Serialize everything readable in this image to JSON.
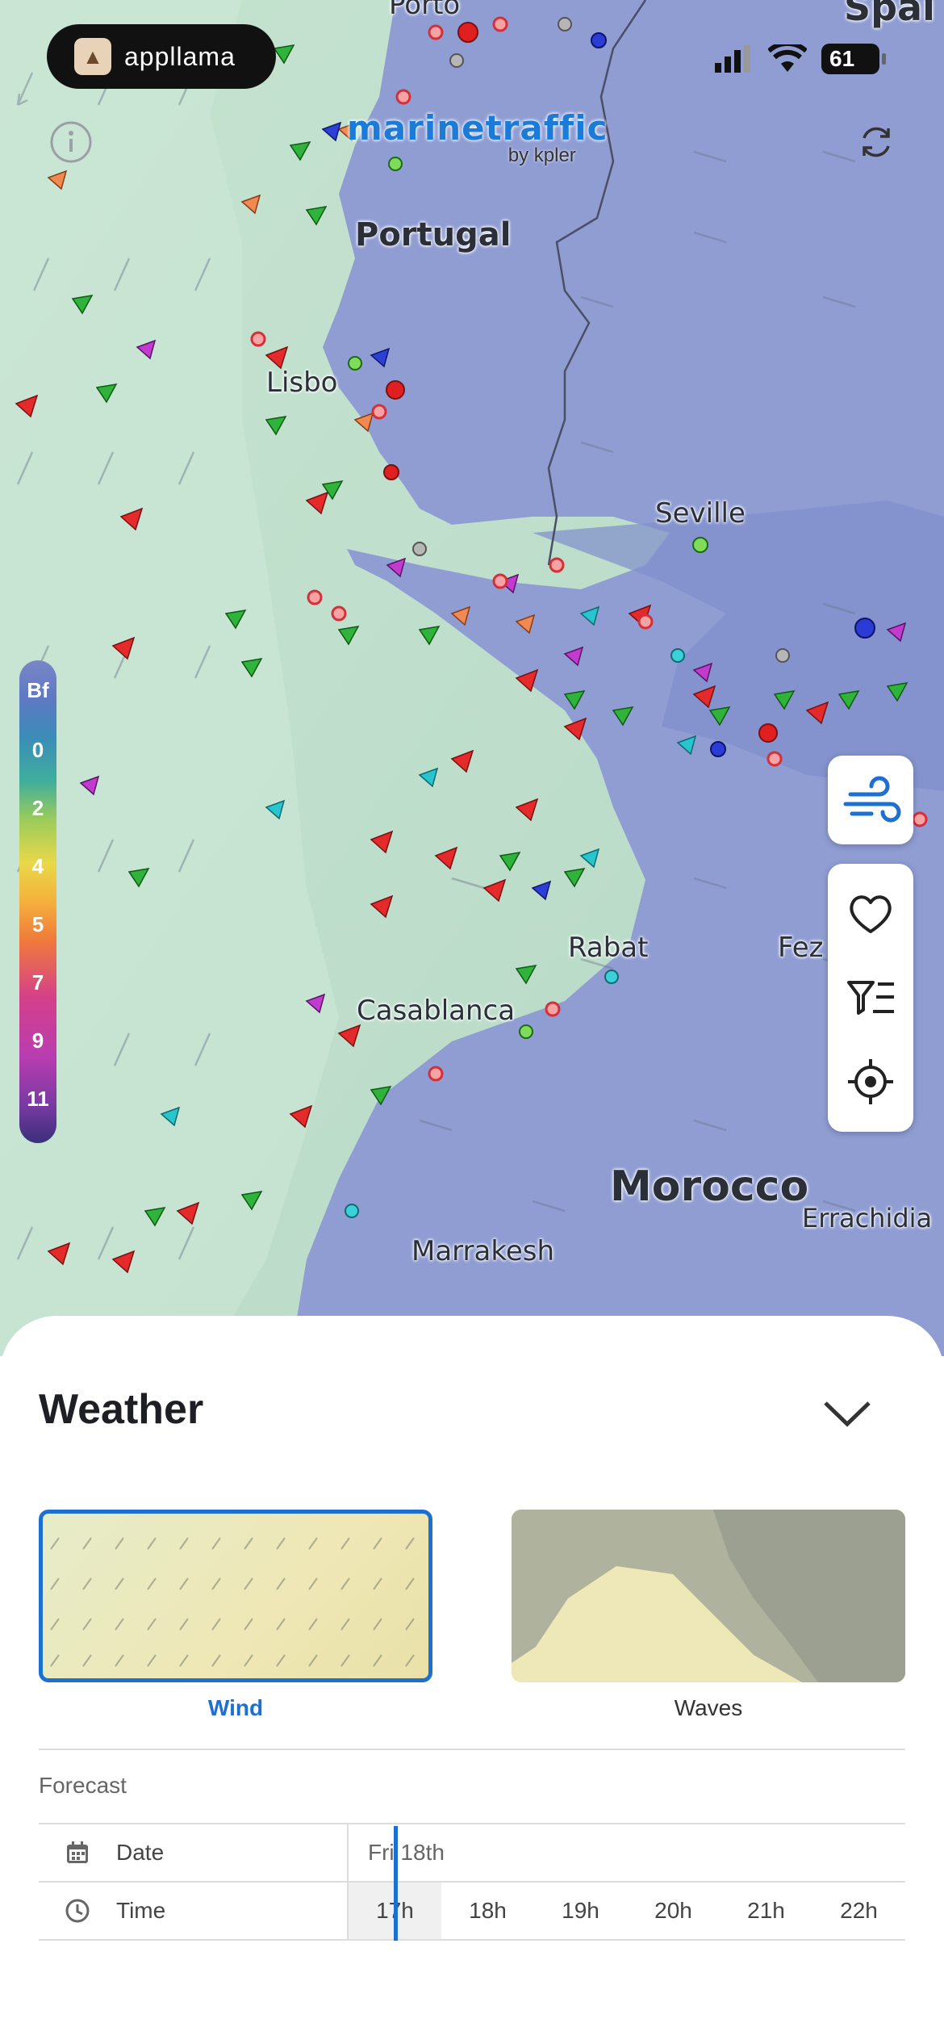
{
  "status_bar": {
    "app_badge": "appllama",
    "battery": "61"
  },
  "brand": {
    "name": "marinetraffic",
    "sub": "by kpler"
  },
  "map": {
    "countries": [
      "Portugal",
      "Morocco",
      "Spai"
    ],
    "cities": [
      "Porto",
      "Lisbo",
      "Seville",
      "Rabat",
      "Fez",
      "Casablanca",
      "Marrakesh",
      "Errachidia"
    ]
  },
  "legend": {
    "title": "Bf",
    "values": [
      "0",
      "2",
      "4",
      "5",
      "7",
      "9",
      "11"
    ]
  },
  "tools": {
    "weather": "wind-layer-icon",
    "favorites": "heart-icon",
    "filter": "filter-list-icon",
    "locate": "locate-icon"
  },
  "weather_sheet": {
    "title": "Weather",
    "layers": [
      {
        "label": "Wind",
        "selected": true
      },
      {
        "label": "Waves",
        "selected": false
      }
    ],
    "forecast_label": "Forecast",
    "date_label": "Date",
    "date_value": "Fri 18th",
    "time_label": "Time",
    "hours": [
      "17h",
      "18h",
      "19h",
      "20h",
      "21h",
      "22h"
    ],
    "selected_hour": "17h"
  },
  "colors": {
    "accent": "#1d6fd0",
    "land": "#c9e4d6",
    "sea": "#8d9bd1"
  }
}
